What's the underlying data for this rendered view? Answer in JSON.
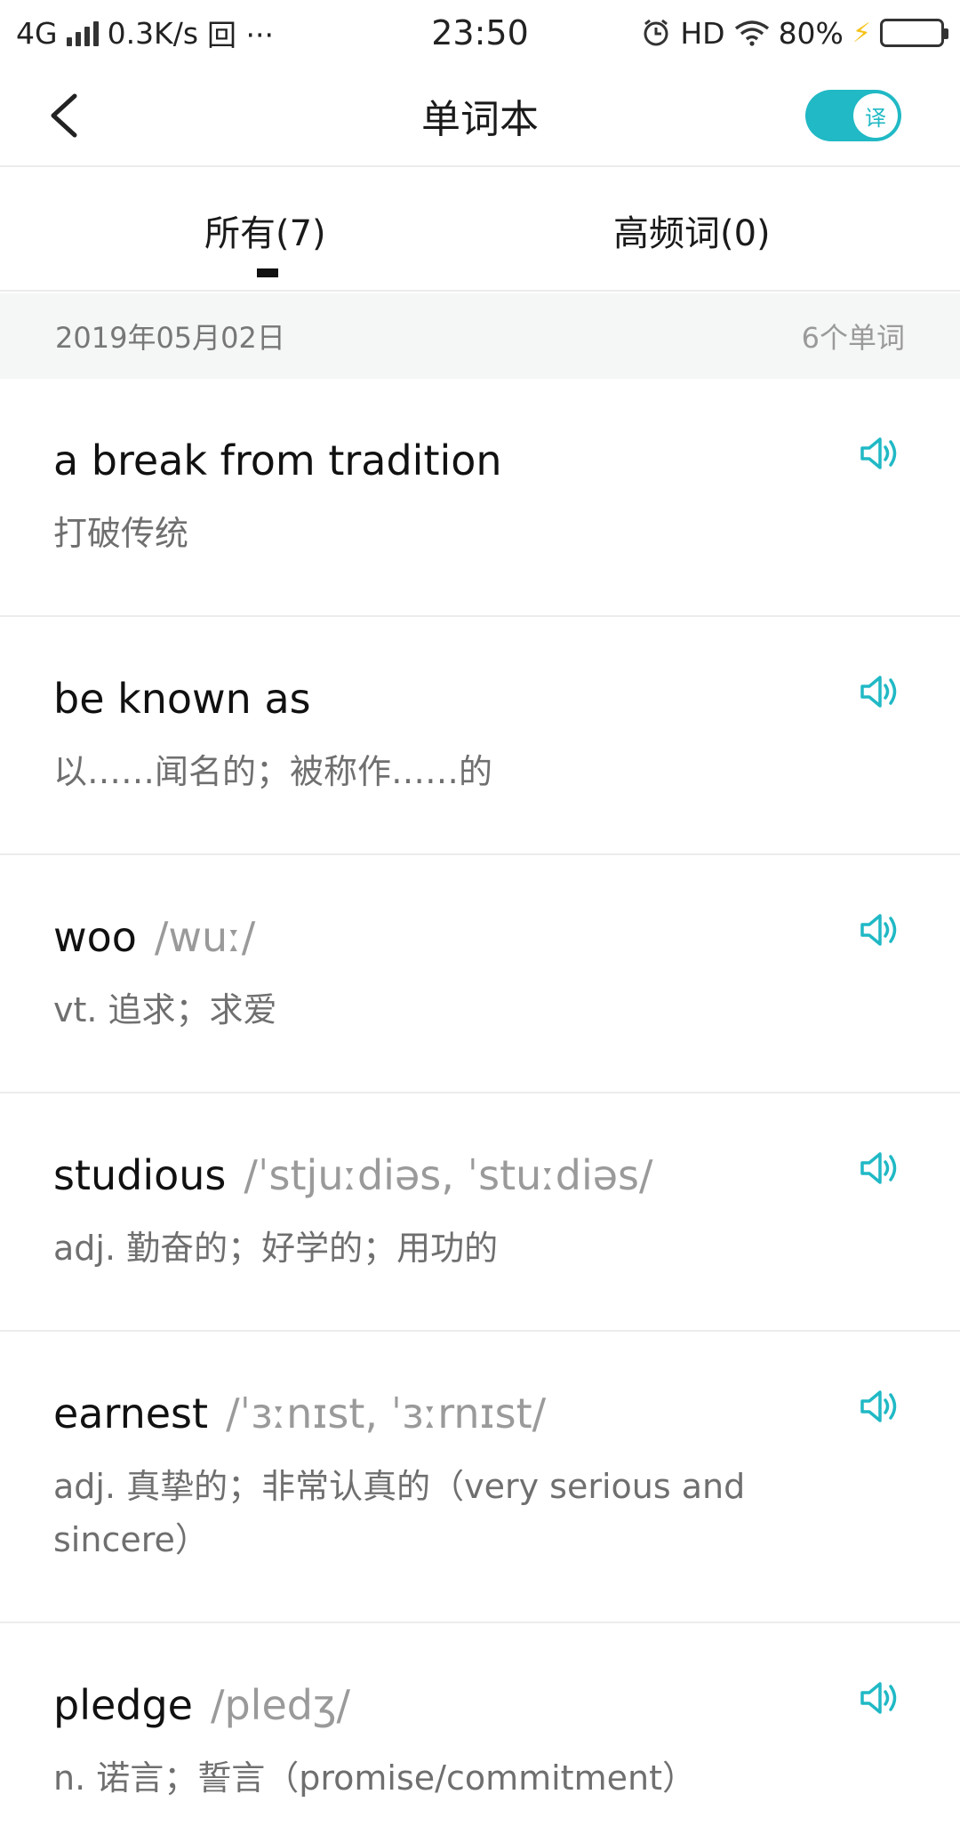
{
  "status_bar": {
    "network": "4G",
    "speed": "0.3K/s",
    "extra": "回 ···",
    "time": "23:50",
    "hd": "HD",
    "battery": "80%",
    "battery_level": 0.8
  },
  "header": {
    "title": "单词本",
    "toggle_label": "译",
    "toggle_on": true
  },
  "tabs": [
    {
      "label": "所有(7)",
      "active": true
    },
    {
      "label": "高频词(0)",
      "active": false
    }
  ],
  "section": {
    "date": "2019年05月02日",
    "count": "6个单词"
  },
  "words": [
    {
      "word": "a break from tradition",
      "phonetic": "",
      "meaning": "打破传统"
    },
    {
      "word": "be known as",
      "phonetic": "",
      "meaning": "以……闻名的；被称作……的"
    },
    {
      "word": "woo",
      "phonetic": "/wuː/",
      "meaning": "vt. 追求；求爱"
    },
    {
      "word": "studious",
      "phonetic": "/ˈstjuːdiəs, ˈstuːdiəs/",
      "meaning": "adj. 勤奋的；好学的；用功的"
    },
    {
      "word": "earnest",
      "phonetic": "/ˈɜːnɪst, ˈɜːrnɪst/",
      "meaning": "adj. 真挚的；非常认真的（very serious and sincere）"
    },
    {
      "word": "pledge",
      "phonetic": "/pledʒ/",
      "meaning": "n. 诺言；誓言（promise/commitment）"
    }
  ],
  "colors": {
    "accent": "#20b9c5",
    "text_primary": "#111111",
    "text_secondary": "#6f6f6f",
    "phonetic": "#9a9a9a",
    "section_bg": "#f5f6f6"
  }
}
